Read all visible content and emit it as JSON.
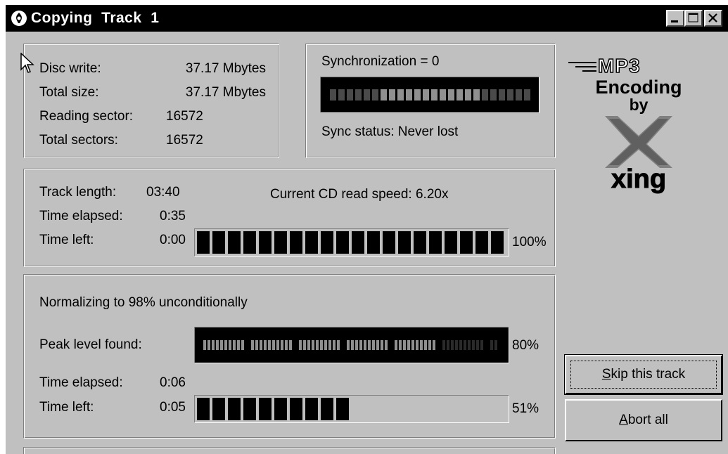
{
  "window": {
    "title": "Copying  Track  1",
    "controls": [
      "minimize-icon",
      "maximize-icon",
      "close-icon"
    ]
  },
  "disc_group": {
    "disc_write_label": "Disc write:",
    "disc_write_value": "37.17 Mbytes",
    "total_size_label": "Total size:",
    "total_size_value": "37.17 Mbytes",
    "reading_sector_label": "Reading sector:",
    "reading_sector_value": "16572",
    "total_sectors_label": "Total sectors:",
    "total_sectors_value": "16572"
  },
  "sync_group": {
    "synchronization_text": "Synchronization = 0",
    "sync_status_text": "Sync status: Never lost",
    "sync_meter_level": 0.5
  },
  "track_group": {
    "track_length_label": "Track length:",
    "track_length_value": "03:40",
    "time_elapsed_label": "Time elapsed:",
    "time_elapsed_value": "0:35",
    "time_left_label": "Time left:",
    "time_left_value": "0:00",
    "read_speed_text": "Current CD read speed: 6.20x",
    "progress_percent_text": "100%",
    "progress_fraction": 1.0
  },
  "normalize_group": {
    "normalizing_text": "Normalizing to 98% unconditionally",
    "peak_label": "Peak level found:",
    "peak_percent_text": "80%",
    "peak_fraction": 0.8,
    "time_elapsed_label": "Time elapsed:",
    "time_elapsed_value": "0:06",
    "time_left_label": "Time left:",
    "time_left_value": "0:05",
    "progress_percent_text": "51%",
    "progress_fraction": 0.51
  },
  "logo": {
    "mp3_text": "MP3",
    "encoding_text": "Encoding",
    "by_text": "by",
    "brand_text": "xing"
  },
  "buttons": {
    "skip_label": "Skip this track",
    "skip_mnemonic": "S",
    "abort_label": "Abort all",
    "abort_mnemonic": "A"
  },
  "colors": {
    "face": "#c0c0c0",
    "segment_on": "#000000",
    "segment_dim": "#2a2a2a",
    "sync_on": "#909090",
    "sync_off": "#4a4a4a"
  }
}
